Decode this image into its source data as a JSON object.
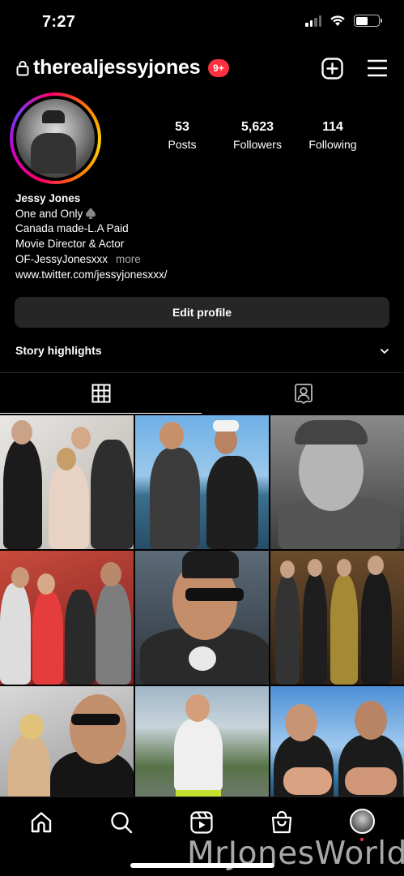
{
  "status_bar": {
    "time": "7:27"
  },
  "header": {
    "username": "therealjessyjones",
    "notification_badge": "9+"
  },
  "profile": {
    "stats": [
      {
        "value": "53",
        "label": "Posts"
      },
      {
        "value": "5,623",
        "label": "Followers"
      },
      {
        "value": "114",
        "label": "Following"
      }
    ],
    "bio": {
      "name": "Jessy Jones",
      "line1": "One and Only",
      "line2": "Canada made-L.A Paid",
      "line3": "Movie Director & Actor",
      "line4": "OF-JessyJonesxxx",
      "more": "more",
      "link": "www.twitter.com/jessyjonesxxx/"
    },
    "edit_profile_label": "Edit profile",
    "story_highlights_label": "Story highlights"
  },
  "tabs": [
    {
      "icon": "grid-icon",
      "active": true
    },
    {
      "icon": "tagged-icon",
      "active": false
    }
  ],
  "colors": {
    "accent_red": "#ff3040",
    "button_bg": "#262626",
    "muted_text": "#a8a8a8"
  },
  "watermark": "MrJonesWorld"
}
